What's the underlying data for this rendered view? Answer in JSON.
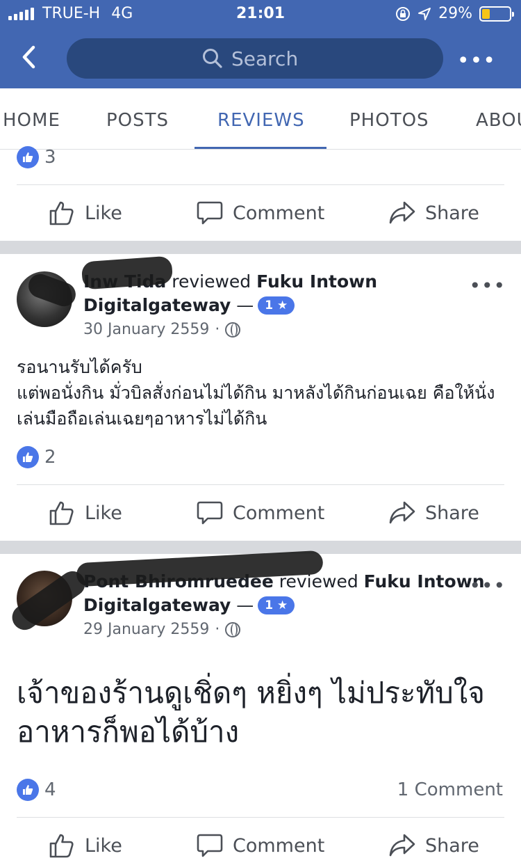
{
  "status_bar": {
    "carrier": "TRUE-H",
    "network": "4G",
    "time": "21:01",
    "battery": "29%",
    "battery_level": 0.29
  },
  "header": {
    "search_placeholder": "Search",
    "more_label": "•••"
  },
  "tabs": [
    {
      "label": "HOME"
    },
    {
      "label": "POSTS"
    },
    {
      "label": "REVIEWS"
    },
    {
      "label": "PHOTOS"
    },
    {
      "label": "ABOUT"
    }
  ],
  "actions": {
    "like": "Like",
    "comment": "Comment",
    "share": "Share"
  },
  "top_post": {
    "like_count": "3"
  },
  "reviews": [
    {
      "reviewer": "Inw Tida",
      "verb": "reviewed",
      "page": "Fuku Intown Digitalgateway",
      "dash": "—",
      "rating": "1 ★",
      "date": "30 January 2559",
      "dot": "·",
      "text": "รอนานรับได้ครับ\nแต่พอนั่งกิน มั่วบิลสั่งก่อนไม่ได้กิน มาหลังได้กินก่อนเฉย คือให้นั่งเล่นมือถือเล่นเฉยๆอาหารไม่ได้กิน",
      "like_count": "2",
      "comments": ""
    },
    {
      "reviewer": "Pont Bhiromruedee",
      "verb": "reviewed",
      "page": "Fuku Intown Digitalgateway",
      "dash": "—",
      "rating": "1 ★",
      "date": "29 January 2559",
      "dot": "·",
      "text": "เจ้าของร้านดูเชิ่ดๆ หยิ่งๆ ไม่ประทับใจ  อาหารก็พอได้บ้าง",
      "like_count": "4",
      "comments": "1 Comment"
    }
  ],
  "colors": {
    "brand": "#4267b2",
    "search_bg": "#29487d",
    "like_badge": "#4a76e8",
    "battery_fill": "#f5c518"
  }
}
